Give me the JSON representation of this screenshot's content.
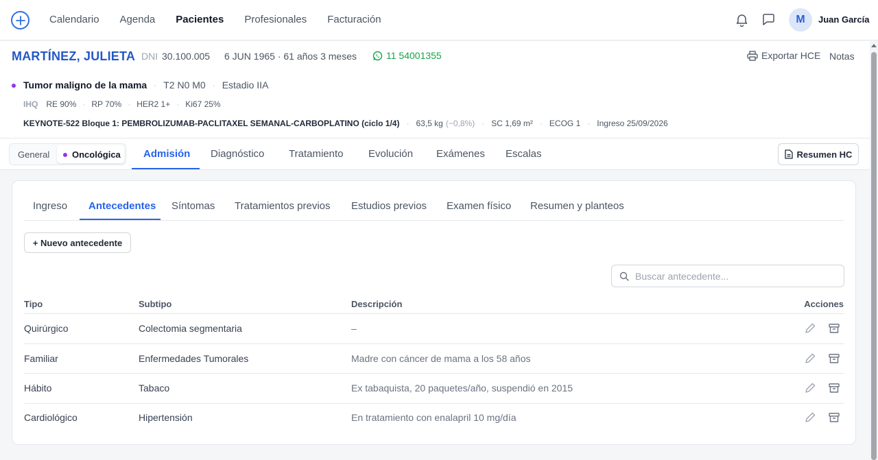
{
  "nav": {
    "items": [
      {
        "label": "Calendario",
        "active": false
      },
      {
        "label": "Agenda",
        "active": false
      },
      {
        "label": "Pacientes",
        "active": true
      },
      {
        "label": "Profesionales",
        "active": false
      },
      {
        "label": "Facturación",
        "active": false
      }
    ],
    "user": {
      "initial": "M",
      "name": "Juan García"
    }
  },
  "patient": {
    "name": "MARTÍNEZ, JULIETA",
    "dni_label": "DNI",
    "dni": "30.100.005",
    "dob_age": "6 JUN 1965 · 61 años 3 meses",
    "phone": "11 54001355",
    "export_label": "Exportar HCE",
    "notes_label": "Notas",
    "diagnosis": {
      "name": "Tumor maligno de la mama",
      "tnm": "T2 N0 M0",
      "stage": "Estadio IIA"
    },
    "ihq": {
      "label": "IHQ",
      "items": [
        "RE 90%",
        "RP 70%",
        "HER2 1+",
        "Ki67 25%"
      ]
    },
    "regimen": {
      "protocol": "KEYNOTE-522 Bloque 1: PEMBROLIZUMAB-PACLITAXEL SEMANAL-CARBOPLATINO (ciclo 1/4)",
      "weight": "63,5 kg",
      "weight_change": "(−0,8%)",
      "sc": "SC 1,69 m²",
      "ecog": "ECOG 1",
      "admission": "Ingreso 25/09/2026"
    }
  },
  "segment": {
    "general": "General",
    "oncologica": "Oncológica"
  },
  "main_tabs": [
    "Admisión",
    "Diagnóstico",
    "Tratamiento",
    "Evolución",
    "Exámenes",
    "Escalas"
  ],
  "resumen_label": "Resumen HC",
  "sub_tabs": [
    "Ingreso",
    "Antecedentes",
    "Síntomas",
    "Tratamientos previos",
    "Estudios previos",
    "Examen físico",
    "Resumen y planteos"
  ],
  "new_button": "+ Nuevo antecedente",
  "search": {
    "placeholder": "Buscar antecedente..."
  },
  "table": {
    "headers": {
      "tipo": "Tipo",
      "subtipo": "Subtipo",
      "descripcion": "Descripción",
      "acciones": "Acciones"
    },
    "rows": [
      {
        "tipo": "Quirúrgico",
        "subtipo": "Colectomia segmentaria",
        "descripcion": "–"
      },
      {
        "tipo": "Familiar",
        "subtipo": "Enfermedades Tumorales",
        "descripcion": "Madre con cáncer de mama a los 58 años"
      },
      {
        "tipo": "Hábito",
        "subtipo": "Tabaco",
        "descripcion": "Ex tabaquista, 20 paquetes/año, suspendió en 2015"
      },
      {
        "tipo": "Cardiológico",
        "subtipo": "Hipertensión",
        "descripcion": "En tratamiento con enalapril 10 mg/día"
      }
    ]
  },
  "colors": {
    "accent": "#2563eb",
    "patient_name": "#2458c7",
    "phone": "#16a34a",
    "oncology_dot": "#9333ea"
  },
  "icons": [
    "plus-icon",
    "bell-icon",
    "chat-icon",
    "whatsapp-icon",
    "printer-icon",
    "document-icon",
    "search-icon",
    "pencil-icon",
    "archive-icon"
  ]
}
